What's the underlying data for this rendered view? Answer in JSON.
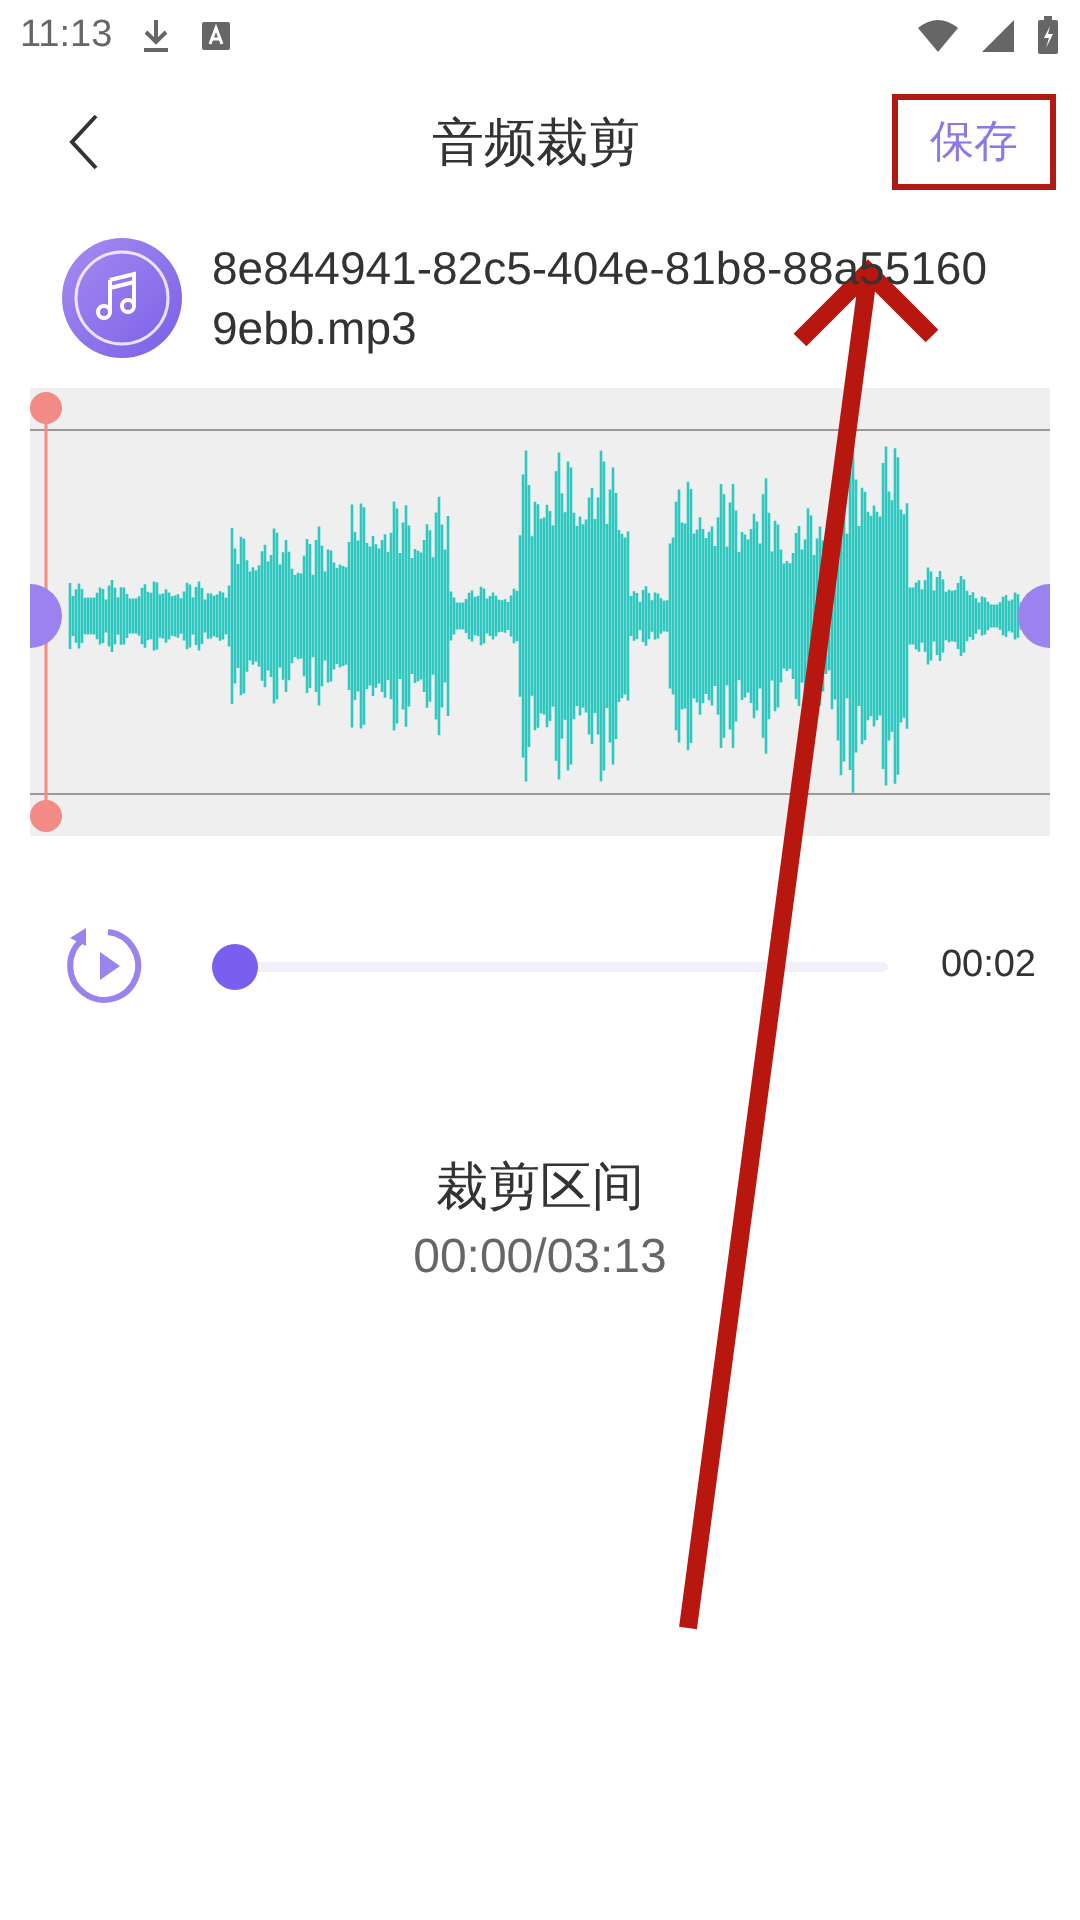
{
  "status_bar": {
    "time": "11:13"
  },
  "header": {
    "title": "音频裁剪",
    "save": "保存",
    "save_highlighted": true
  },
  "file": {
    "name": "8e844941-82c5-404e-81b8-88a551609ebb.mp3"
  },
  "player": {
    "level": 0,
    "elapsed": "00:02"
  },
  "range": {
    "label": "裁剪区间",
    "value": "00:00/03:13"
  }
}
